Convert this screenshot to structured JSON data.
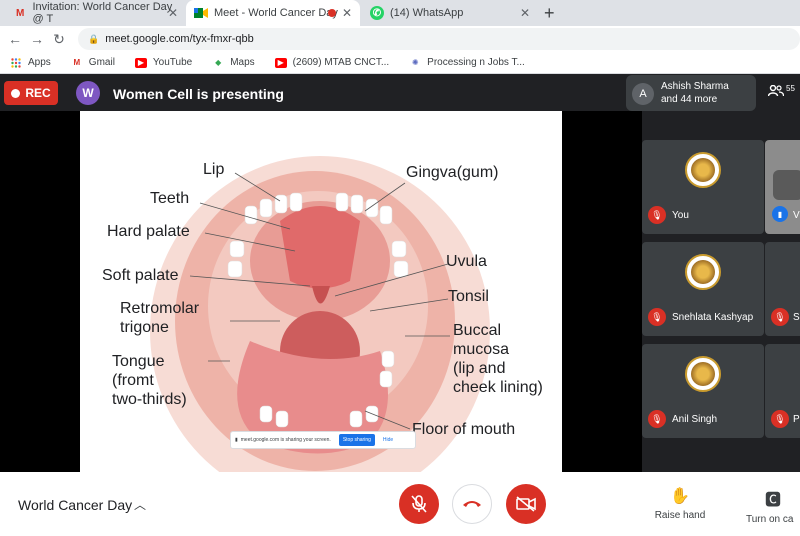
{
  "browser": {
    "tabs": [
      {
        "label": "Invitation: World Cancer Day @ T",
        "icon": "gmail-icon"
      },
      {
        "label": "Meet - World Cancer Day",
        "icon": "meet-icon"
      },
      {
        "label": "(14) WhatsApp",
        "icon": "whatsapp-icon"
      }
    ],
    "url": "meet.google.com/tyx-fmxr-qbb",
    "bookmarks": [
      {
        "label": "Apps"
      },
      {
        "label": "Gmail"
      },
      {
        "label": "YouTube"
      },
      {
        "label": "Maps"
      },
      {
        "label": "(2609) MTAB CNCT..."
      },
      {
        "label": "Processing n Jobs T..."
      }
    ]
  },
  "meet": {
    "rec_label": "REC",
    "presenter_initial": "W",
    "presenting_text": "Women Cell is presenting",
    "participant_initial": "A",
    "participant_name": "Ashish Sharma",
    "participant_more": "and 44 more",
    "people_count": "55",
    "share_text": "meet.google.com is sharing your screen.",
    "stop_sharing": "Stop sharing",
    "hide": "Hide",
    "tiles": [
      {
        "name": "You"
      },
      {
        "name": "Snehlata Kashyap"
      },
      {
        "name": "Anil Singh"
      }
    ],
    "side_tiles": [
      {
        "initial": "V"
      },
      {
        "initial": "S"
      },
      {
        "initial": "P"
      }
    ],
    "meeting_name": "World Cancer Day",
    "raise_hand": "Raise hand",
    "turn_on_captions": "Turn on ca"
  },
  "slide": {
    "labels": {
      "lip": "Lip",
      "teeth": "Teeth",
      "hard_palate": "Hard palate",
      "soft_palate": "Soft palate",
      "retromolar": "Retromolar",
      "trigone": "trigone",
      "tongue1": "Tongue",
      "tongue2": "(fromt",
      "tongue3": "two-thirds)",
      "gingva": "Gingva(gum)",
      "uvula": "Uvula",
      "tonsil": "Tonsil",
      "buccal1": "Buccal",
      "buccal2": "mucosa",
      "buccal3": "(lip and",
      "buccal4": "cheek lining)",
      "floor": "Floor of mouth"
    }
  }
}
